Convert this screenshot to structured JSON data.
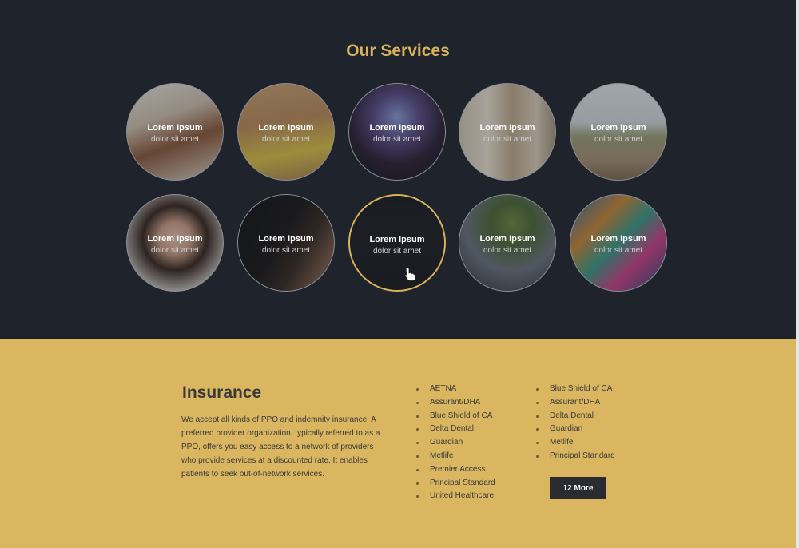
{
  "services": {
    "title": "Our Services",
    "items": [
      {
        "label": "Lorem Ipsum",
        "sub": "dolor sit amet",
        "image": "woman-headscarf-photo"
      },
      {
        "label": "Lorem Ipsum",
        "sub": "dolor sit amet",
        "image": "two-women-yellow-photo"
      },
      {
        "label": "Lorem Ipsum",
        "sub": "dolor sit amet",
        "image": "concert-crowd-photo"
      },
      {
        "label": "Lorem Ipsum",
        "sub": "dolor sit amet",
        "image": "building-tree-photo"
      },
      {
        "label": "Lorem Ipsum",
        "sub": "dolor sit amet",
        "image": "boardwalk-photo"
      },
      {
        "label": "Lorem Ipsum",
        "sub": "dolor sit amet",
        "image": "woman-glasses-photo"
      },
      {
        "label": "Lorem Ipsum",
        "sub": "dolor sit amet",
        "image": "man-dark-portrait-photo"
      },
      {
        "label": "Lorem Ipsum",
        "sub": "dolor sit amet",
        "image": "woman-dark-portrait-photo"
      },
      {
        "label": "Lorem Ipsum",
        "sub": "dolor sit amet",
        "image": "plant-leaves-photo"
      },
      {
        "label": "Lorem Ipsum",
        "sub": "dolor sit amet",
        "image": "toy-blocks-photo"
      }
    ]
  },
  "insurance": {
    "title": "Insurance",
    "description": "We accept all kinds of PPO and indemnity insurance. A preferred provider organization, typically referred to as a PPO, offers you easy access to a network of providers who provide services at a discounted rate. It enables patients to seek out-of-network services.",
    "list1": [
      "AETNA",
      "Assurant/DHA",
      "Blue Shield of CA",
      "Delta Dental",
      "Guardian",
      "Metlife",
      "Premier Access",
      "Principal Standard",
      "United Healthcare"
    ],
    "list2": [
      "Blue Shield of CA",
      "Assurant/DHA",
      "Delta Dental",
      "Guardian",
      "Metlife",
      "Principal Standard"
    ],
    "more_button": "12 More"
  },
  "colors": {
    "dark_bg": "#1f232b",
    "accent_gold": "#d8b35a",
    "insurance_bg": "#d9b65f",
    "button_dark": "#2a2c31"
  }
}
